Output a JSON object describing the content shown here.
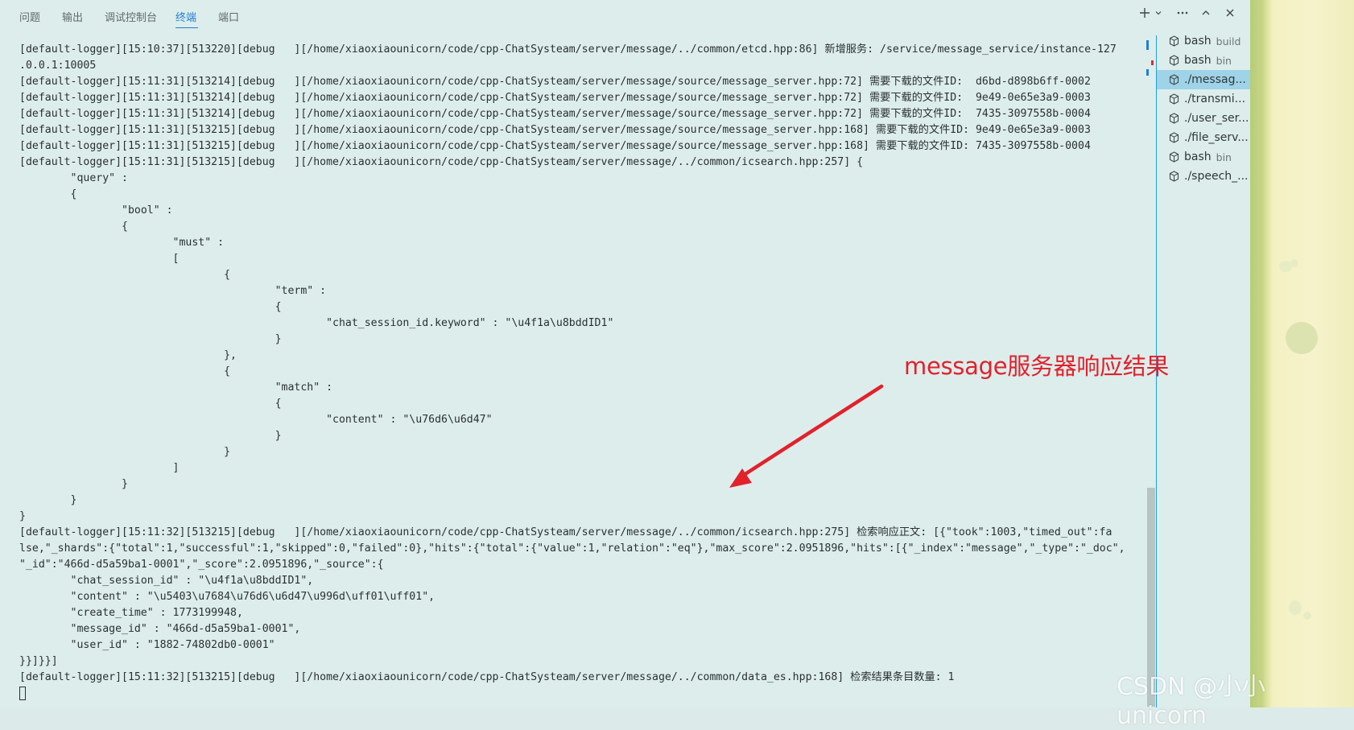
{
  "tabs": [
    "问题",
    "输出",
    "调试控制台",
    "终端",
    "端口"
  ],
  "active_tab": "终端",
  "terminal_lines": [
    "[default-logger][15:10:37][513220][debug   ][/home/xiaoxiaounicorn/code/cpp-ChatSysteam/server/message/../common/etcd.hpp:86] 新增服务: /service/message_service/instance-127",
    ".0.0.1:10005",
    "[default-logger][15:11:31][513214][debug   ][/home/xiaoxiaounicorn/code/cpp-ChatSysteam/server/message/source/message_server.hpp:72] 需要下载的文件ID:  d6bd-d898b6ff-0002",
    "[default-logger][15:11:31][513214][debug   ][/home/xiaoxiaounicorn/code/cpp-ChatSysteam/server/message/source/message_server.hpp:72] 需要下载的文件ID:  9e49-0e65e3a9-0003",
    "[default-logger][15:11:31][513214][debug   ][/home/xiaoxiaounicorn/code/cpp-ChatSysteam/server/message/source/message_server.hpp:72] 需要下载的文件ID:  7435-3097558b-0004",
    "[default-logger][15:11:31][513215][debug   ][/home/xiaoxiaounicorn/code/cpp-ChatSysteam/server/message/source/message_server.hpp:168] 需要下载的文件ID: 9e49-0e65e3a9-0003",
    "[default-logger][15:11:31][513215][debug   ][/home/xiaoxiaounicorn/code/cpp-ChatSysteam/server/message/source/message_server.hpp:168] 需要下载的文件ID: 7435-3097558b-0004",
    "[default-logger][15:11:31][513215][debug   ][/home/xiaoxiaounicorn/code/cpp-ChatSysteam/server/message/../common/icsearch.hpp:257] {",
    "        \"query\" :",
    "        {",
    "                \"bool\" :",
    "                {",
    "                        \"must\" :",
    "                        [",
    "                                {",
    "                                        \"term\" :",
    "                                        {",
    "                                                \"chat_session_id.keyword\" : \"\\u4f1a\\u8bddID1\"",
    "                                        }",
    "                                },",
    "                                {",
    "                                        \"match\" :",
    "                                        {",
    "                                                \"content\" : \"\\u76d6\\u6d47\"",
    "                                        }",
    "                                }",
    "                        ]",
    "                }",
    "        }",
    "}",
    "[default-logger][15:11:32][513215][debug   ][/home/xiaoxiaounicorn/code/cpp-ChatSysteam/server/message/../common/icsearch.hpp:275] 检索响应正文: [{\"took\":1003,\"timed_out\":fa",
    "lse,\"_shards\":{\"total\":1,\"successful\":1,\"skipped\":0,\"failed\":0},\"hits\":{\"total\":{\"value\":1,\"relation\":\"eq\"},\"max_score\":2.0951896,\"hits\":[{\"_index\":\"message\",\"_type\":\"_doc\",",
    "\"_id\":\"466d-d5a59ba1-0001\",\"_score\":2.0951896,\"_source\":{",
    "        \"chat_session_id\" : \"\\u4f1a\\u8bddID1\",",
    "        \"content\" : \"\\u5403\\u7684\\u76d6\\u6d47\\u996d\\uff01\\uff01\",",
    "        \"create_time\" : 1773199948,",
    "        \"message_id\" : \"466d-d5a59ba1-0001\",",
    "        \"user_id\" : \"1882-74802db0-0001\"",
    "}}]}}]",
    "[default-logger][15:11:32][513215][debug   ][/home/xiaoxiaounicorn/code/cpp-ChatSysteam/server/message/../common/data_es.hpp:168] 检索结果条目数量: 1"
  ],
  "terminal_list": [
    {
      "name": "bash",
      "sub": "build"
    },
    {
      "name": "bash",
      "sub": "bin"
    },
    {
      "name": "./messag...",
      "sub": ""
    },
    {
      "name": "./transmi...",
      "sub": ""
    },
    {
      "name": "./user_ser...",
      "sub": ""
    },
    {
      "name": "./file_serv...",
      "sub": ""
    },
    {
      "name": "bash",
      "sub": "bin"
    },
    {
      "name": "./speech_...",
      "sub": ""
    }
  ],
  "active_terminal_index": 2,
  "annotation": "message服务器响应结果",
  "watermark": "CSDN @小小unicorn",
  "colors": {
    "accent": "#1e7fd6",
    "annotation_red": "#e2212b",
    "panel_bg": "#ddedec",
    "active_item_bg": "#9fd3e8"
  },
  "icons": {
    "add": "plus-icon",
    "dropdown": "chevron-down-icon",
    "more": "ellipsis-icon",
    "maximize": "chevron-up-icon",
    "close": "close-icon",
    "terminal": "terminal-cube-icon"
  }
}
